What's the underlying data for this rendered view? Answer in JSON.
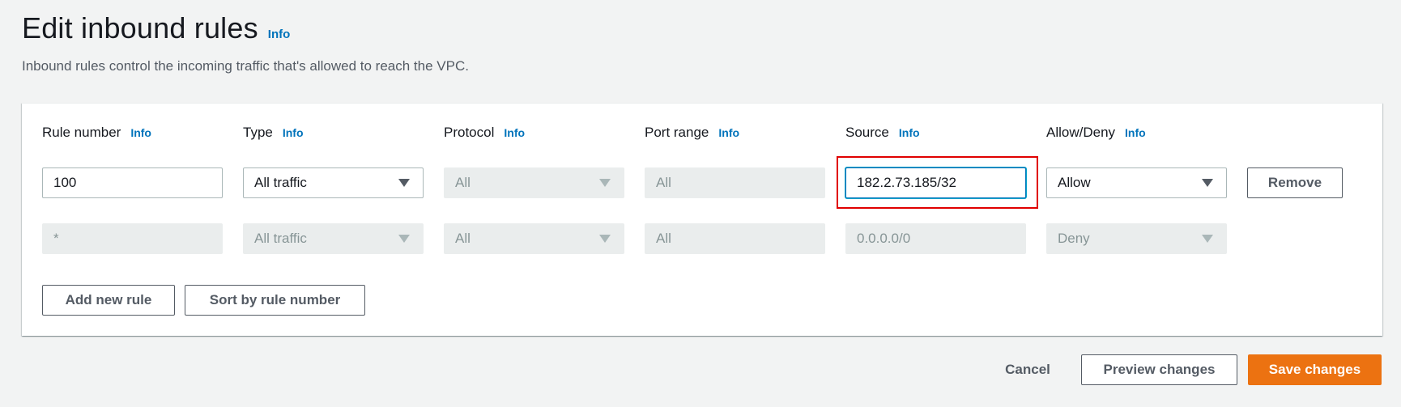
{
  "page": {
    "title": "Edit inbound rules",
    "title_info": "Info",
    "description": "Inbound rules control the incoming traffic that's allowed to reach the VPC."
  },
  "columns": [
    {
      "label": "Rule number",
      "info": "Info"
    },
    {
      "label": "Type",
      "info": "Info"
    },
    {
      "label": "Protocol",
      "info": "Info"
    },
    {
      "label": "Port range",
      "info": "Info"
    },
    {
      "label": "Source",
      "info": "Info"
    },
    {
      "label": "Allow/Deny",
      "info": "Info"
    }
  ],
  "rules": [
    {
      "rule_number": "100",
      "type": "All traffic",
      "protocol": "All",
      "port_range": "All",
      "source": "182.2.73.185/32",
      "action": "Allow",
      "remove_label": "Remove"
    },
    {
      "rule_number": "*",
      "type": "All traffic",
      "protocol": "All",
      "port_range": "All",
      "source": "0.0.0.0/0",
      "action": "Deny"
    }
  ],
  "panel_actions": {
    "add_rule": "Add new rule",
    "sort": "Sort by rule number"
  },
  "footer": {
    "cancel": "Cancel",
    "preview": "Preview changes",
    "save": "Save changes"
  },
  "colors": {
    "accent": "#ec7211",
    "link": "#0073bb",
    "focus": "#00a1c9",
    "highlight": "#e00000"
  }
}
